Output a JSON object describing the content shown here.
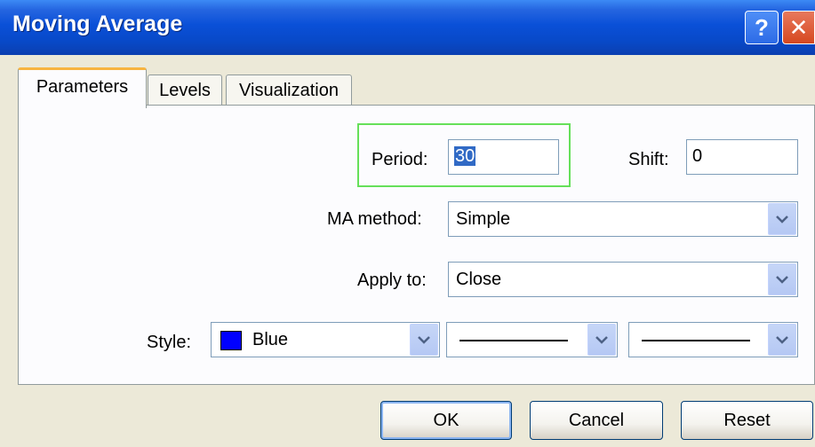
{
  "window": {
    "title": "Moving Average",
    "help_glyph": "?",
    "close_glyph": "✕"
  },
  "tabs": [
    {
      "label": "Parameters",
      "active": true
    },
    {
      "label": "Levels",
      "active": false
    },
    {
      "label": "Visualization",
      "active": false
    }
  ],
  "params": {
    "period_label": "Period:",
    "period_value": "30",
    "shift_label": "Shift:",
    "shift_value": "0",
    "ma_method_label": "MA method:",
    "ma_method_value": "Simple",
    "apply_to_label": "Apply to:",
    "apply_to_value": "Close",
    "style_label": "Style:",
    "style_color_name": "Blue",
    "style_color_hex": "#0000ff"
  },
  "buttons": {
    "ok": "OK",
    "cancel": "Cancel",
    "reset": "Reset"
  },
  "icons": {
    "dropdown": "chevron-down-icon"
  }
}
